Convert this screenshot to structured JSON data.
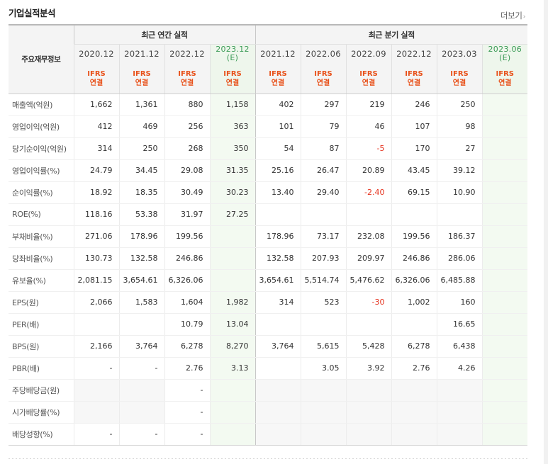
{
  "header": {
    "title": "기업실적분석",
    "more_label": "더보기",
    "more_chevron": "›"
  },
  "table": {
    "corner_label": "주요재무정보",
    "annual_group_label": "최근 연간 실적",
    "quarter_group_label": "최근 분기 실적",
    "periods": [
      {
        "label": "2020.12",
        "est": ""
      },
      {
        "label": "2021.12",
        "est": ""
      },
      {
        "label": "2022.12",
        "est": ""
      },
      {
        "label": "2023.12",
        "est": "(E)"
      },
      {
        "label": "2021.12",
        "est": ""
      },
      {
        "label": "2022.06",
        "est": ""
      },
      {
        "label": "2022.09",
        "est": ""
      },
      {
        "label": "2022.12",
        "est": ""
      },
      {
        "label": "2023.03",
        "est": ""
      },
      {
        "label": "2023.06",
        "est": "(E)"
      }
    ],
    "ifrs_top": "IFRS",
    "ifrs_bottom": "연결",
    "rows": [
      {
        "label": "매출액(억원)",
        "values": [
          "1,662",
          "1,361",
          "880",
          "1,158",
          "402",
          "297",
          "219",
          "246",
          "250",
          ""
        ]
      },
      {
        "label": "영업이익(억원)",
        "values": [
          "412",
          "469",
          "256",
          "363",
          "101",
          "79",
          "46",
          "107",
          "98",
          ""
        ]
      },
      {
        "label": "당기순이익(억원)",
        "values": [
          "314",
          "250",
          "268",
          "350",
          "54",
          "87",
          "-5",
          "170",
          "27",
          ""
        ]
      },
      {
        "label": "영업이익률(%)",
        "values": [
          "24.79",
          "34.45",
          "29.08",
          "31.35",
          "25.16",
          "26.47",
          "20.89",
          "43.45",
          "39.12",
          ""
        ]
      },
      {
        "label": "순이익률(%)",
        "values": [
          "18.92",
          "18.35",
          "30.49",
          "30.23",
          "13.40",
          "29.40",
          "-2.40",
          "69.15",
          "10.90",
          ""
        ]
      },
      {
        "label": "ROE(%)",
        "values": [
          "118.16",
          "53.38",
          "31.97",
          "27.25",
          "",
          "",
          "",
          "",
          "",
          ""
        ]
      },
      {
        "label": "부채비율(%)",
        "values": [
          "271.06",
          "178.96",
          "199.56",
          "",
          "178.96",
          "73.17",
          "232.08",
          "199.56",
          "186.37",
          ""
        ]
      },
      {
        "label": "당좌비율(%)",
        "values": [
          "130.73",
          "132.58",
          "246.86",
          "",
          "132.58",
          "207.93",
          "209.97",
          "246.86",
          "286.06",
          ""
        ]
      },
      {
        "label": "유보율(%)",
        "values": [
          "2,081.15",
          "3,654.61",
          "6,326.06",
          "",
          "3,654.61",
          "5,514.74",
          "5,476.62",
          "6,326.06",
          "6,485.88",
          ""
        ]
      },
      {
        "label": "EPS(원)",
        "values": [
          "2,066",
          "1,583",
          "1,604",
          "1,982",
          "314",
          "523",
          "-30",
          "1,002",
          "160",
          ""
        ]
      },
      {
        "label": "PER(배)",
        "values": [
          "",
          "",
          "10.79",
          "13.04",
          "",
          "",
          "",
          "",
          "16.65",
          ""
        ]
      },
      {
        "label": "BPS(원)",
        "values": [
          "2,166",
          "3,764",
          "6,278",
          "8,270",
          "3,764",
          "5,615",
          "5,428",
          "6,278",
          "6,438",
          ""
        ]
      },
      {
        "label": "PBR(배)",
        "values": [
          "-",
          "-",
          "2.76",
          "3.13",
          "",
          "3.05",
          "3.92",
          "2.76",
          "4.26",
          ""
        ]
      },
      {
        "label": "주당배당금(원)",
        "values": [
          "",
          "",
          "-",
          "",
          "",
          "",
          "",
          "",
          "",
          ""
        ]
      },
      {
        "label": "시가배당률(%)",
        "values": [
          "",
          "",
          "-",
          "",
          "",
          "",
          "",
          "",
          "",
          ""
        ]
      },
      {
        "label": "배당성향(%)",
        "values": [
          "-",
          "-",
          "-",
          "",
          "",
          "",
          "",
          "",
          "",
          ""
        ]
      }
    ]
  },
  "colors": {
    "ifrs": "#e8511a",
    "estimate_text": "#3a9a55",
    "estimate_bg": "#f3faf1",
    "negative": "#e5301c"
  }
}
